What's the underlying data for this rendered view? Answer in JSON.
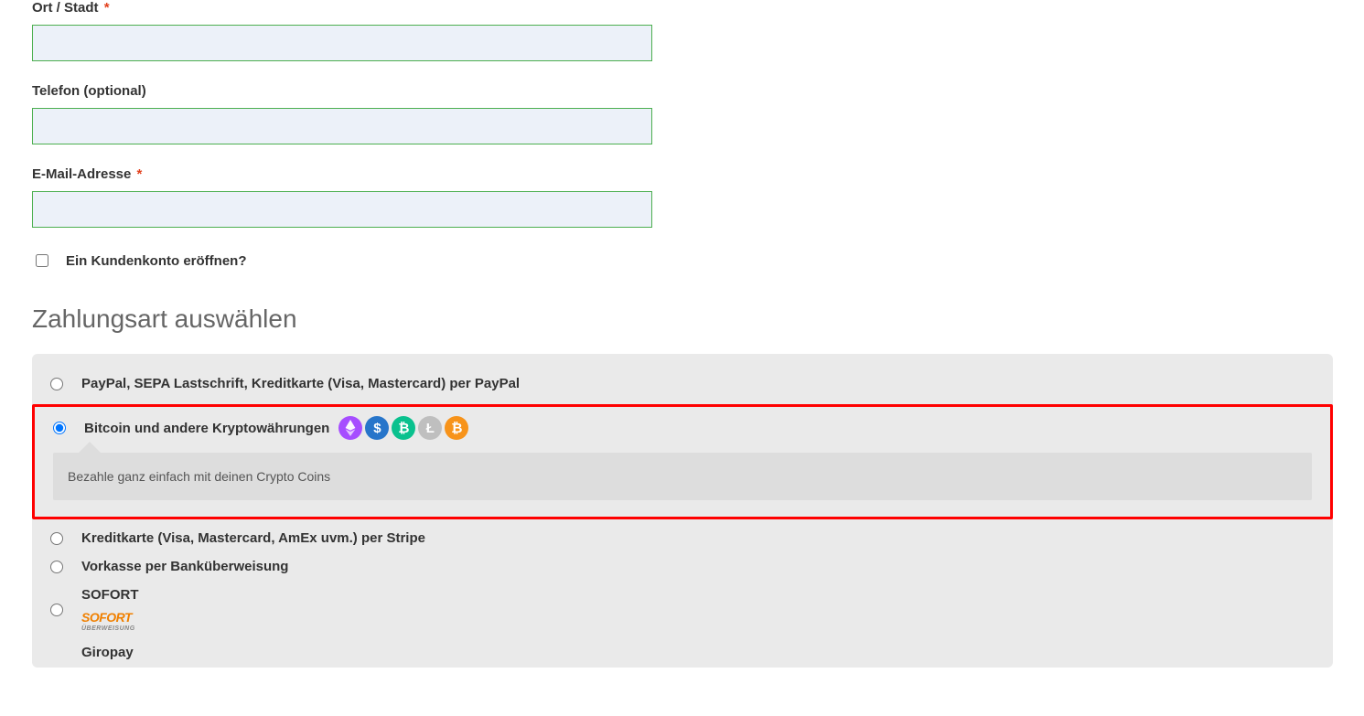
{
  "form": {
    "city": {
      "label": "Ort / Stadt",
      "required": true,
      "value": ""
    },
    "phone": {
      "label": "Telefon (optional)",
      "required": false,
      "value": ""
    },
    "email": {
      "label": "E-Mail-Adresse",
      "required": true,
      "value": ""
    },
    "create_account_label": "Ein Kundenkonto eröffnen?",
    "create_account_checked": false
  },
  "section_title": "Zahlungsart auswählen",
  "payment_options": {
    "paypal": {
      "label": "PayPal, SEPA Lastschrift, Kreditkarte (Visa, Mastercard) per PayPal",
      "selected": false
    },
    "crypto": {
      "label": "Bitcoin und andere Kryptowährungen",
      "selected": true,
      "info_text": "Bezahle ganz einfach mit deinen Crypto Coins",
      "coins": [
        "eth",
        "usdc",
        "bch",
        "ltc",
        "btc"
      ]
    },
    "stripe": {
      "label": "Kreditkarte (Visa, Mastercard, AmEx uvm.) per Stripe",
      "selected": false
    },
    "vorkasse": {
      "label": "Vorkasse per Banküberweisung",
      "selected": false
    },
    "sofort": {
      "label": "SOFORT",
      "logo_main": "SOFORT",
      "logo_sub": "ÜBERWEISUNG",
      "selected": false
    },
    "giropay": {
      "label": "Giropay",
      "selected": false
    }
  },
  "required_marker": "*"
}
